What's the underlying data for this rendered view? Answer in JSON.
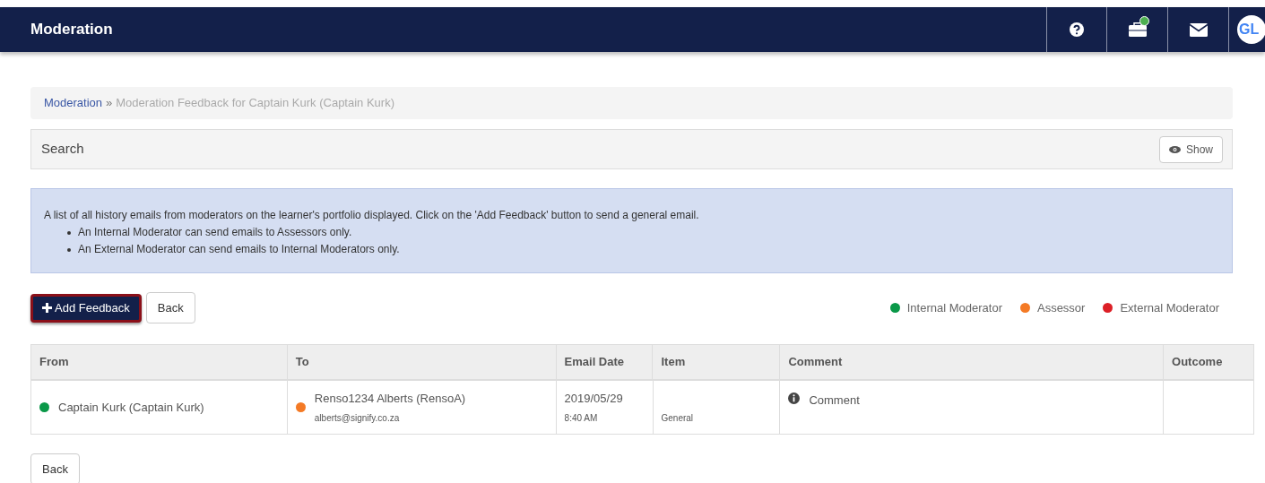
{
  "header": {
    "title": "Moderation",
    "avatar": "GL",
    "notification": true
  },
  "breadcrumb": {
    "link": "Moderation",
    "separator": "»",
    "current": "Moderation Feedback for Captain Kurk (Captain Kurk)"
  },
  "search": {
    "title": "Search",
    "button": "Show"
  },
  "info": {
    "text": "A list of all history emails from moderators on the learner's portfolio displayed. Click on the 'Add Feedback' button to send a general email.",
    "bullets": [
      "An Internal Moderator can send emails to Assessors only.",
      "An External Moderator can send emails to Internal Moderators only."
    ]
  },
  "actions": {
    "add": "Add Feedback",
    "back": "Back"
  },
  "legend": [
    {
      "label": "Internal Moderator",
      "color": "#0a9848"
    },
    {
      "label": "Assessor",
      "color": "#f47a25"
    },
    {
      "label": "External Moderator",
      "color": "#dc1f26"
    }
  ],
  "table": {
    "columns": [
      "From",
      "To",
      "Email Date",
      "Item",
      "Comment",
      "Outcome"
    ],
    "rows": [
      {
        "from": {
          "name": "Captain Kurk (Captain Kurk)",
          "color": "#0a9848"
        },
        "to": {
          "name": "Renso1234 Alberts (RensoA)",
          "color": "#f47a25",
          "email": "alberts@signify.co.za"
        },
        "date": "2019/05/29",
        "time": "8:40 AM",
        "item": "General",
        "comment": "Comment"
      }
    ]
  },
  "footer_back": "Back"
}
